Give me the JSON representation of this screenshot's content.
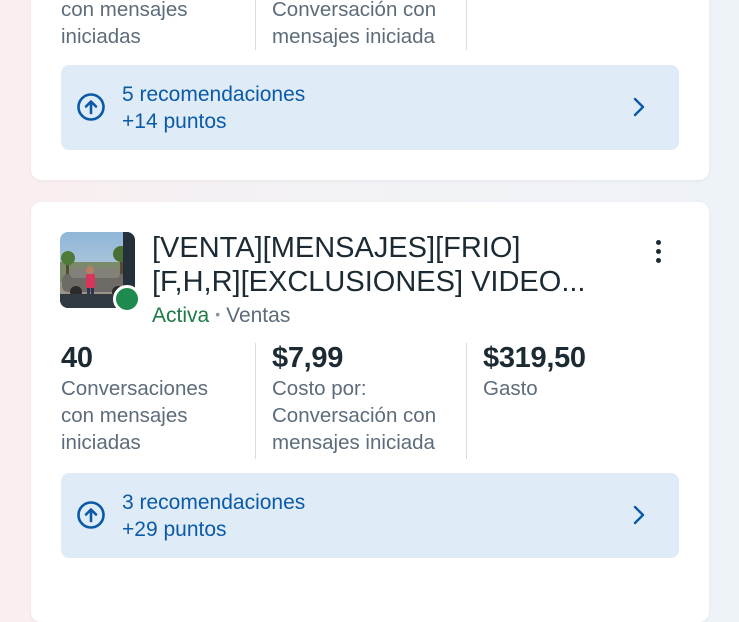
{
  "cards": [
    {
      "metrics": [
        {
          "label_lines": [
            "con mensajes",
            "iniciadas"
          ]
        },
        {
          "label_lines": [
            "Conversación con",
            "mensajes iniciada"
          ]
        }
      ],
      "recommendation": {
        "count": "5 recomendaciones",
        "points": "+14 puntos"
      }
    },
    {
      "title_lines": [
        "[VENTA][MENSAJES][FRIO]",
        "[F,H,R][EXCLUSIONES] VIDEO..."
      ],
      "status": "Activa",
      "separator": "•",
      "objective": "Ventas",
      "metrics": [
        {
          "value": "40",
          "label_lines": [
            "Conversaciones",
            "con mensajes",
            "iniciadas"
          ]
        },
        {
          "value": "$7,99",
          "label_lines": [
            "Costo por:",
            "Conversación con",
            "mensajes iniciada"
          ]
        },
        {
          "value": "$319,50",
          "label_lines": [
            "Gasto"
          ]
        }
      ],
      "recommendation": {
        "count": "3 recomendaciones",
        "points": "+29 puntos"
      }
    }
  ],
  "icons": {
    "recommendation": "arrow-up-circle-icon",
    "chevron": "chevron-right-icon",
    "more": "more-vertical-icon",
    "status": "active-status-dot"
  },
  "colors": {
    "link_blue": "#0a5aa8",
    "reco_bg": "#dfecf7",
    "active_green": "#1e8a4d"
  }
}
